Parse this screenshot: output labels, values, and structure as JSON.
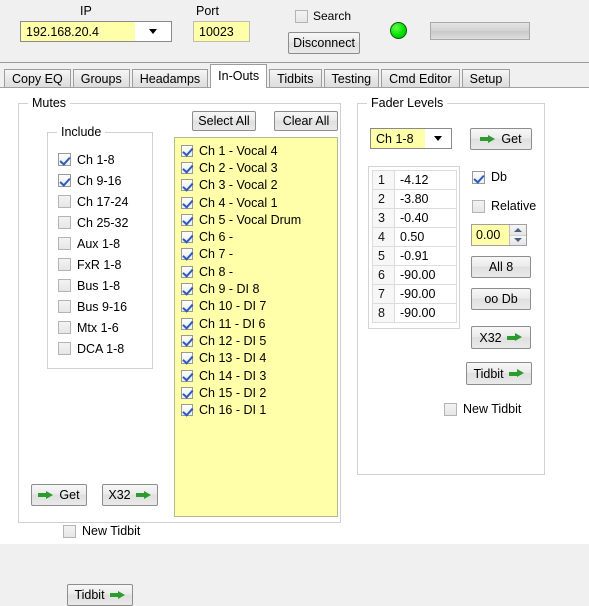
{
  "topbar": {
    "ip_label": "IP",
    "ip_value": "192.168.20.4",
    "port_label": "Port",
    "port_value": "10023",
    "search_label": "Search",
    "search_checked": false,
    "disconnect_label": "Disconnect",
    "led_color": "#00e000",
    "led_name": "connection-status-led"
  },
  "tabs": [
    {
      "label": "Copy EQ",
      "active": false
    },
    {
      "label": "Groups",
      "active": false
    },
    {
      "label": "Headamps",
      "active": false
    },
    {
      "label": "In-Outs",
      "active": true
    },
    {
      "label": "Tidbits",
      "active": false
    },
    {
      "label": "Testing",
      "active": false
    },
    {
      "label": "Cmd Editor",
      "active": false
    },
    {
      "label": "Setup",
      "active": false
    }
  ],
  "mutes": {
    "title": "Mutes",
    "include_title": "Include",
    "include_items": [
      {
        "label": "Ch 1-8",
        "checked": true
      },
      {
        "label": "Ch 9-16",
        "checked": true
      },
      {
        "label": "Ch 17-24",
        "checked": false
      },
      {
        "label": "Ch 25-32",
        "checked": false
      },
      {
        "label": "Aux 1-8",
        "checked": false
      },
      {
        "label": "FxR 1-8",
        "checked": false
      },
      {
        "label": "Bus 1-8",
        "checked": false
      },
      {
        "label": "Bus 9-16",
        "checked": false
      },
      {
        "label": "Mtx 1-6",
        "checked": false
      },
      {
        "label": "DCA 1-8",
        "checked": false
      }
    ],
    "select_all_label": "Select All",
    "clear_all_label": "Clear All",
    "channels": [
      {
        "label": "Ch 1 - Vocal 4",
        "checked": true
      },
      {
        "label": "Ch 2 - Vocal 3",
        "checked": true
      },
      {
        "label": "Ch 3 - Vocal 2",
        "checked": true
      },
      {
        "label": "Ch 4 - Vocal 1",
        "checked": true
      },
      {
        "label": "Ch 5 - Vocal Drum",
        "checked": true
      },
      {
        "label": "Ch 6 - ",
        "checked": true
      },
      {
        "label": "Ch 7 - ",
        "checked": true
      },
      {
        "label": "Ch 8 - ",
        "checked": true
      },
      {
        "label": "Ch 9 - DI 8",
        "checked": true
      },
      {
        "label": "Ch 10 - DI 7",
        "checked": true
      },
      {
        "label": "Ch 11 - DI 6",
        "checked": true
      },
      {
        "label": "Ch 12 - DI 5",
        "checked": true
      },
      {
        "label": "Ch 13 - DI 4",
        "checked": true
      },
      {
        "label": "Ch 14 - DI 3",
        "checked": true
      },
      {
        "label": "Ch 15 - DI 2",
        "checked": true
      },
      {
        "label": "Ch 16 - DI 1",
        "checked": true
      }
    ],
    "get_label": "Get",
    "x32_label": "X32",
    "new_tidbit_label": "New Tidbit",
    "new_tidbit_checked": false,
    "tidbit_label": "Tidbit"
  },
  "fader": {
    "title": "Fader Levels",
    "range_value": "Ch 1-8",
    "get_label": "Get",
    "rows": [
      {
        "index": "1",
        "value": "-4.12"
      },
      {
        "index": "2",
        "value": "-3.80"
      },
      {
        "index": "3",
        "value": "-0.40"
      },
      {
        "index": "4",
        "value": "0.50"
      },
      {
        "index": "5",
        "value": "-0.91"
      },
      {
        "index": "6",
        "value": "-90.00"
      },
      {
        "index": "7",
        "value": "-90.00"
      },
      {
        "index": "8",
        "value": "-90.00"
      }
    ],
    "db_label": "Db",
    "db_checked": true,
    "relative_label": "Relative",
    "relative_checked": false,
    "spinner_value": "0.00",
    "all8_label": "All 8",
    "oodb_label": "oo Db",
    "x32_label": "X32",
    "tidbit_label": "Tidbit",
    "new_tidbit_label": "New Tidbit",
    "new_tidbit_checked": false
  },
  "chart_data": null
}
